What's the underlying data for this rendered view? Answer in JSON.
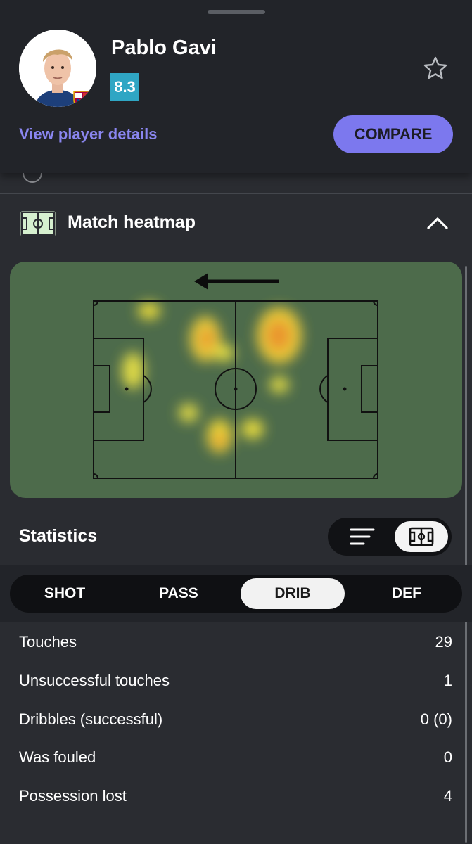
{
  "player": {
    "name": "Pablo Gavi",
    "rating": "8.3",
    "details_link": "View player details",
    "compare_label": "COMPARE"
  },
  "heatmap": {
    "title": "Match heatmap",
    "attack_direction": "left"
  },
  "statistics": {
    "title": "Statistics",
    "tabs": [
      {
        "label": "SHOT",
        "active": false
      },
      {
        "label": "PASS",
        "active": false
      },
      {
        "label": "DRIB",
        "active": true
      },
      {
        "label": "DEF",
        "active": false
      }
    ],
    "rows": [
      {
        "label": "Touches",
        "value": "29"
      },
      {
        "label": "Unsuccessful touches",
        "value": "1"
      },
      {
        "label": "Dribbles (successful)",
        "value": "0 (0)"
      },
      {
        "label": "Was fouled",
        "value": "0"
      },
      {
        "label": "Possession lost",
        "value": "4"
      }
    ]
  },
  "colors": {
    "accent": "#7c78ee",
    "rating_badge": "#2fa6c4",
    "pitch": "#4d6b4b"
  },
  "icons": [
    "star-icon",
    "field-icon",
    "chevron-up-icon",
    "arrow-left-icon",
    "list-icon",
    "pitch-icon"
  ]
}
